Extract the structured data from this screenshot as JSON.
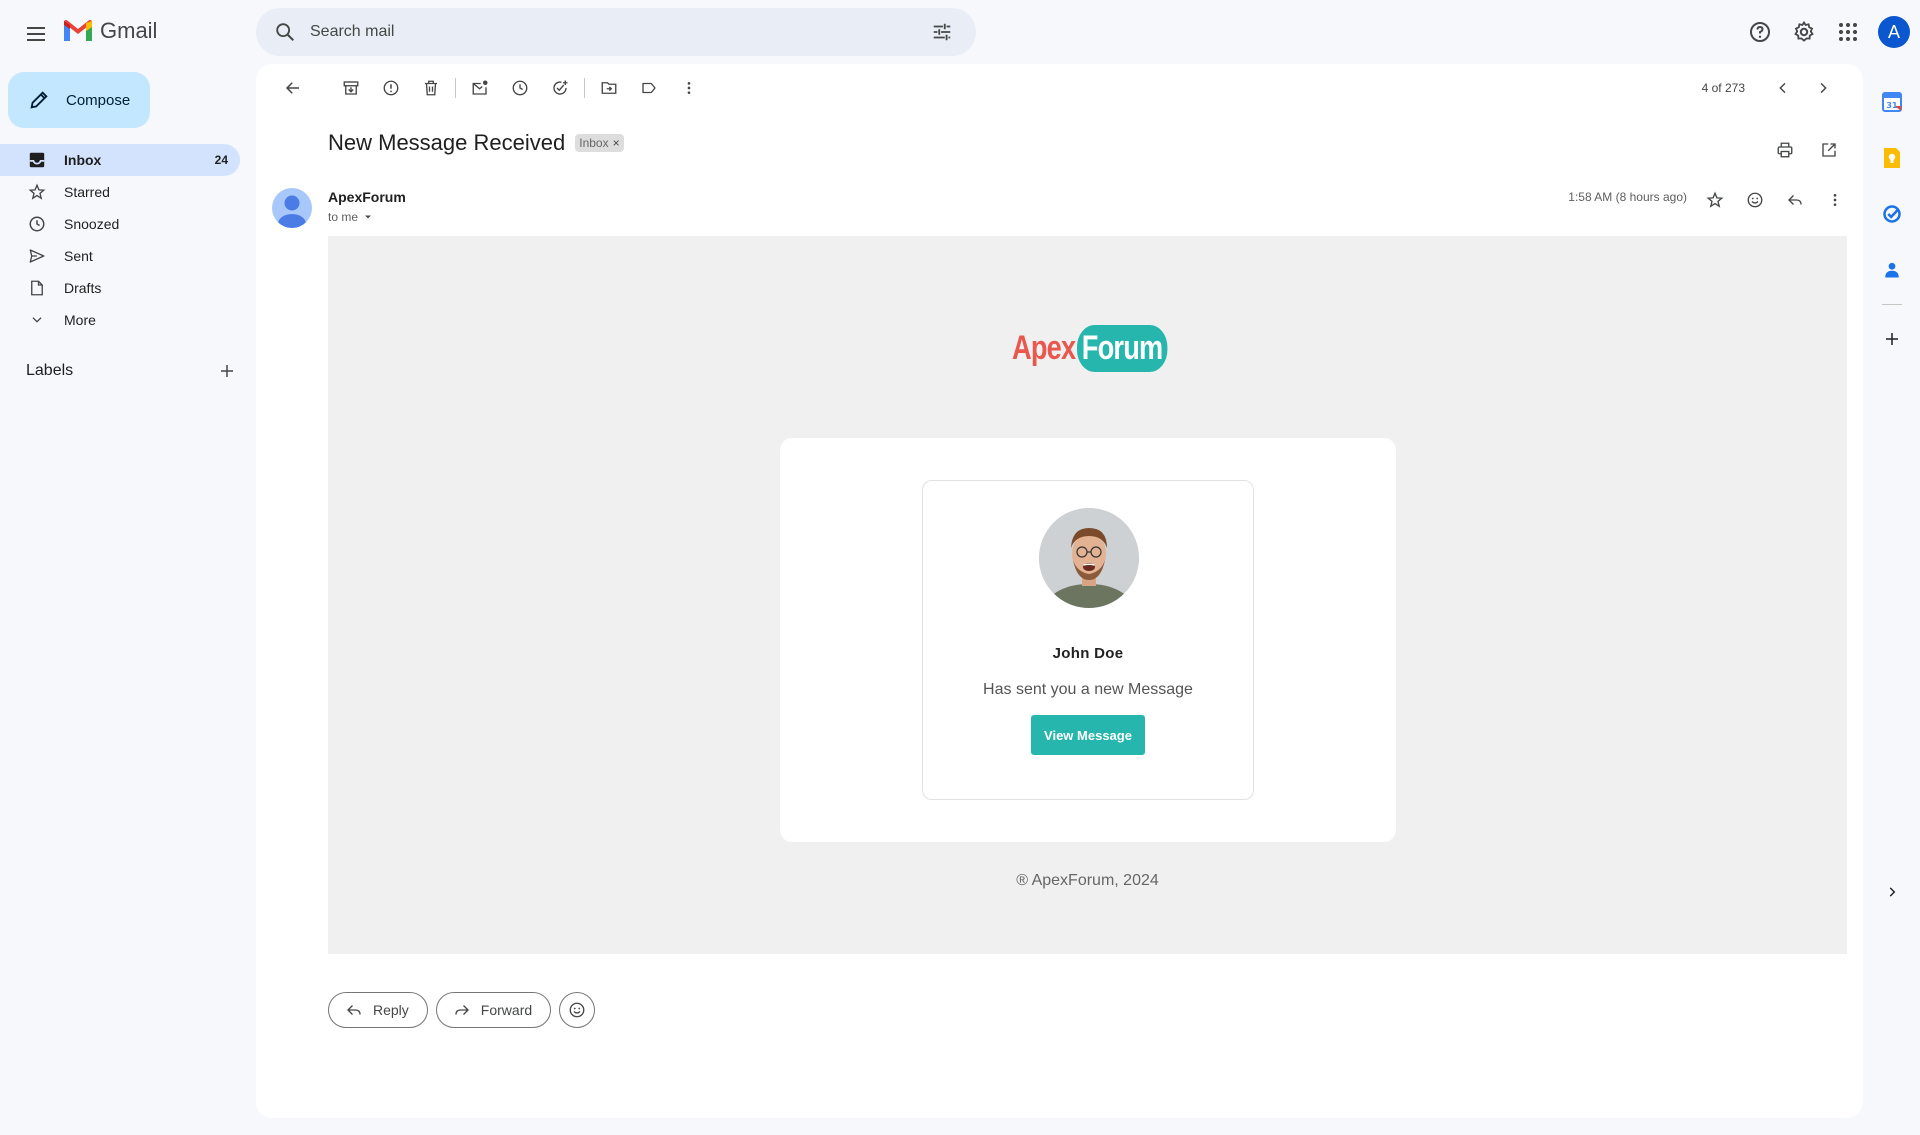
{
  "app": {
    "name": "Gmail"
  },
  "search": {
    "placeholder": "Search mail"
  },
  "compose": {
    "label": "Compose"
  },
  "nav": {
    "inbox": {
      "label": "Inbox",
      "count": "24"
    },
    "starred": {
      "label": "Starred"
    },
    "snoozed": {
      "label": "Snoozed"
    },
    "sent": {
      "label": "Sent"
    },
    "drafts": {
      "label": "Drafts"
    },
    "more": {
      "label": "More"
    }
  },
  "labels": {
    "heading": "Labels"
  },
  "account": {
    "initial": "A"
  },
  "pager": {
    "text": "4 of 273"
  },
  "message": {
    "subject": "New Message Received",
    "label_chip": "Inbox",
    "chip_close": "×",
    "sender": "ApexForum",
    "recipient": "to me",
    "time": "1:58 AM (8 hours ago)"
  },
  "email": {
    "brand_part1": "Apex",
    "brand_part2": "Forum",
    "profile_name": "John Doe",
    "profile_message": "Has sent you a new Message",
    "cta": "View Message",
    "footer": "® ApexForum, 2024",
    "brand_colors": {
      "red": "#e8584f",
      "teal": "#26b6ae"
    }
  },
  "actions": {
    "reply": "Reply",
    "forward": "Forward"
  },
  "icons": [
    "menu-icon",
    "search-icon",
    "tune-icon",
    "help-icon",
    "settings-icon",
    "apps-icon",
    "pencil-icon",
    "inbox-icon",
    "star-icon",
    "clock-icon",
    "send-icon",
    "draft-icon",
    "chevron-down-icon",
    "plus-icon",
    "back-arrow-icon",
    "archive-icon",
    "report-icon",
    "trash-icon",
    "mark-unread-icon",
    "snooze-icon",
    "add-task-icon",
    "move-to-icon",
    "label-icon",
    "more-vert-icon",
    "chevron-left-icon",
    "chevron-right-icon",
    "print-icon",
    "open-new-window-icon",
    "emoji-icon",
    "reply-icon",
    "forward-icon",
    "calendar-icon",
    "keep-icon",
    "tasks-icon",
    "contacts-icon"
  ]
}
